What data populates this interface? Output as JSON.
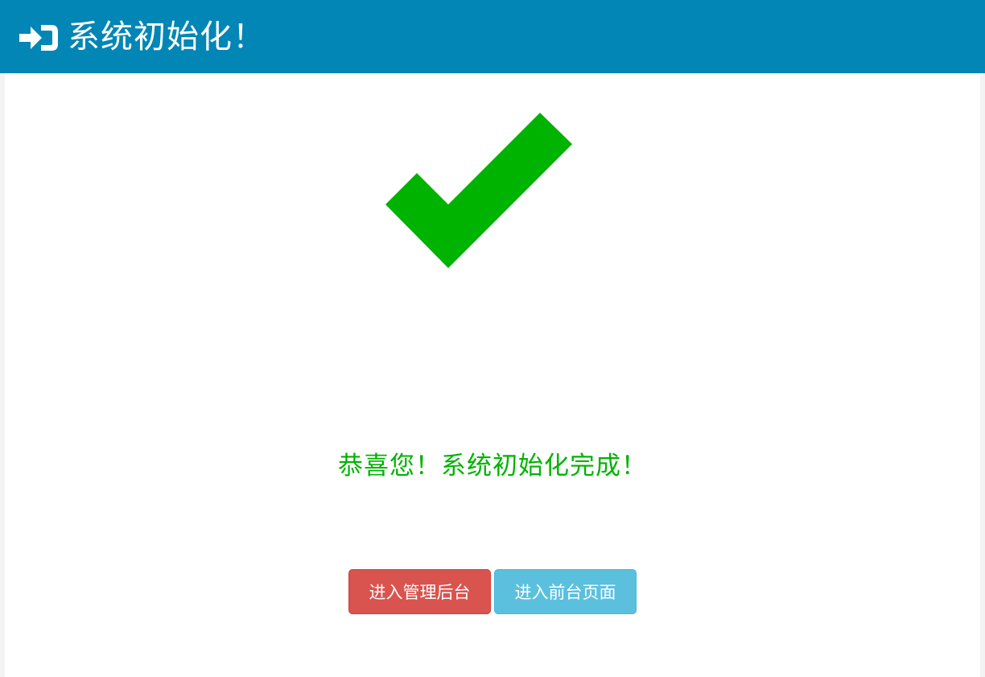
{
  "header": {
    "icon": "sign-in-icon",
    "title": "系统初始化！"
  },
  "main": {
    "status_icon": "checkmark-icon",
    "message": "恭喜您！系统初始化完成！",
    "buttons": {
      "admin_label": "进入管理后台",
      "front_label": "进入前台页面"
    }
  },
  "colors": {
    "header_bg": "#0286b5",
    "success": "#00b300",
    "danger": "#d9534f",
    "info": "#5bc0de"
  }
}
